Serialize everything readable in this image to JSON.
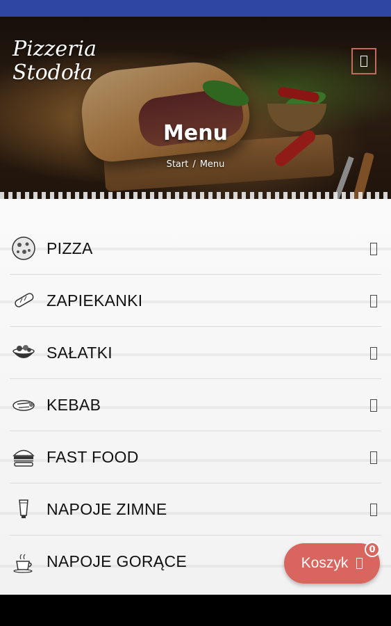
{
  "header": {
    "logo_line1": "Pizzeria",
    "logo_line2": "Stodoła",
    "title": "Menu",
    "breadcrumb": [
      "Start",
      "Menu"
    ],
    "breadcrumb_separator": "/"
  },
  "menu": {
    "items": [
      {
        "label": "PIZZA",
        "icon": "pizza-icon"
      },
      {
        "label": "ZAPIEKANKI",
        "icon": "baguette-icon"
      },
      {
        "label": "SAŁATKI",
        "icon": "salad-bowl-icon"
      },
      {
        "label": "KEBAB",
        "icon": "kebab-wrap-icon"
      },
      {
        "label": "FAST FOOD",
        "icon": "burger-icon"
      },
      {
        "label": "NAPOJE ZIMNE",
        "icon": "glass-icon"
      },
      {
        "label": "NAPOJE GORĄCE",
        "icon": "hot-cup-icon"
      }
    ]
  },
  "cart": {
    "label": "Koszyk",
    "count": "0"
  },
  "colors": {
    "status_bar": "#2f46a3",
    "accent": "#d9655f"
  }
}
